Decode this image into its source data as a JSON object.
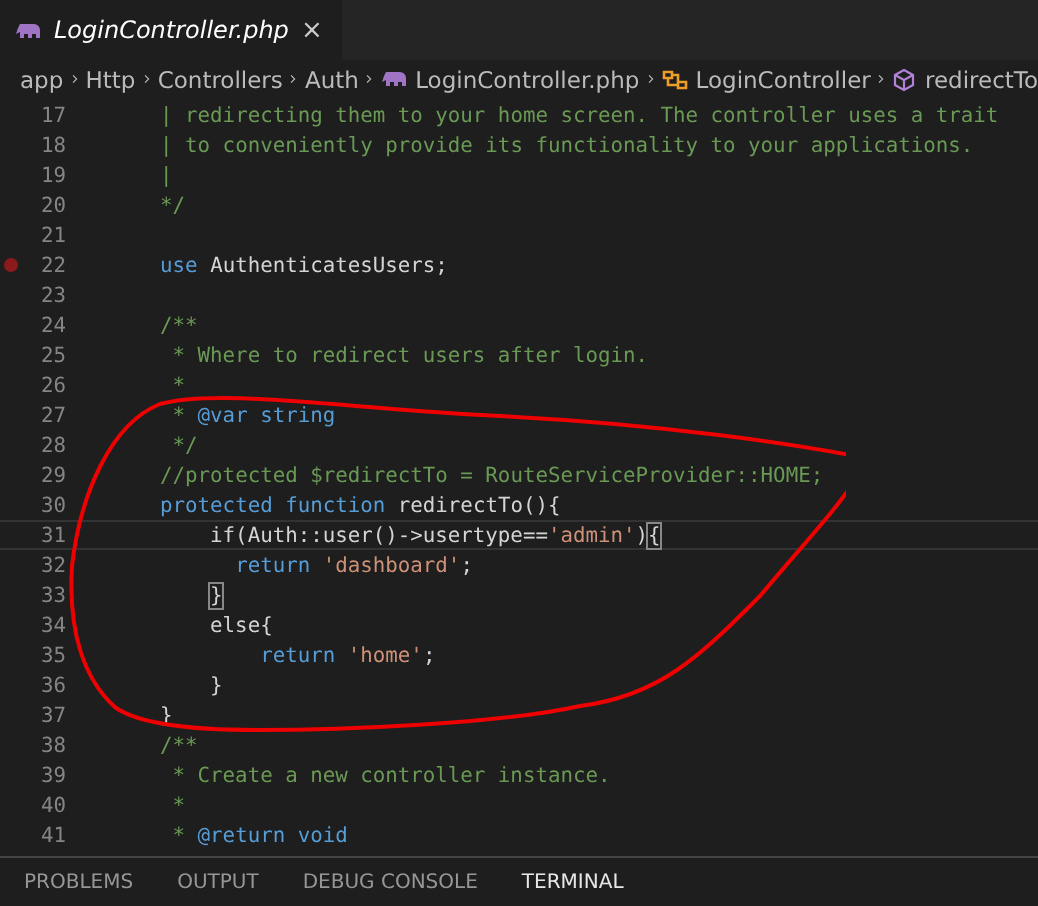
{
  "tab": {
    "label": "LoginController.php",
    "close": "×",
    "selected": true
  },
  "breadcrumb": [
    {
      "label": "app"
    },
    {
      "label": "Http"
    },
    {
      "label": "Controllers"
    },
    {
      "label": "Auth"
    },
    {
      "label": "LoginController.php",
      "kind": "php"
    },
    {
      "label": "LoginController",
      "kind": "class"
    },
    {
      "label": "redirectTo",
      "kind": "method"
    }
  ],
  "lines": [
    {
      "number": "17",
      "breakpoint": false,
      "current": false,
      "tokens": [
        {
          "kind": "comment",
          "text": "    | redirecting them to your home screen. The controller uses a trait"
        }
      ]
    },
    {
      "number": "18",
      "breakpoint": false,
      "current": false,
      "tokens": [
        {
          "kind": "comment",
          "text": "    | to conveniently provide its functionality to your applications."
        }
      ]
    },
    {
      "number": "19",
      "breakpoint": false,
      "current": false,
      "tokens": [
        {
          "kind": "comment",
          "text": "    |"
        }
      ]
    },
    {
      "number": "20",
      "breakpoint": false,
      "current": false,
      "tokens": [
        {
          "kind": "comment",
          "text": "    */"
        }
      ]
    },
    {
      "number": "21",
      "breakpoint": false,
      "current": false
    },
    {
      "number": "22",
      "breakpoint": true,
      "current": false,
      "tokens": [
        {
          "kind": "keyword",
          "text": "    use"
        },
        {
          "kind": "plain",
          "text": " AuthenticatesUsers;"
        }
      ]
    },
    {
      "number": "23",
      "breakpoint": false,
      "current": false
    },
    {
      "number": "24",
      "breakpoint": false,
      "current": false,
      "tokens": [
        {
          "kind": "comment",
          "text": "    /**"
        }
      ]
    },
    {
      "number": "25",
      "breakpoint": false,
      "current": false,
      "tokens": [
        {
          "kind": "comment",
          "text": "     * Where to redirect users after login."
        }
      ]
    },
    {
      "number": "26",
      "breakpoint": false,
      "current": false,
      "tokens": [
        {
          "kind": "comment",
          "text": "     *"
        }
      ]
    },
    {
      "number": "27",
      "breakpoint": false,
      "current": false,
      "tokens": [
        {
          "kind": "comment",
          "text": "     * "
        },
        {
          "kind": "doctag",
          "text": "@var string"
        }
      ]
    },
    {
      "number": "28",
      "breakpoint": false,
      "current": false,
      "tokens": [
        {
          "kind": "comment",
          "text": "     */"
        }
      ]
    },
    {
      "number": "29",
      "breakpoint": false,
      "current": false,
      "tokens": [
        {
          "kind": "comment",
          "text": "    //protected $redirectTo = RouteServiceProvider::HOME;"
        }
      ]
    },
    {
      "number": "30",
      "breakpoint": false,
      "current": false,
      "tokens": [
        {
          "kind": "keyword",
          "text": "    protected function"
        },
        {
          "kind": "plain",
          "text": " redirectTo(){"
        }
      ]
    },
    {
      "number": "31",
      "breakpoint": false,
      "current": true,
      "tokens": [
        {
          "kind": "plain",
          "text": "        if(Auth::user()->usertype=="
        },
        {
          "kind": "string",
          "text": "'admin'"
        },
        {
          "kind": "plain",
          "text": ")"
        },
        {
          "kind": "bracket",
          "text": "{"
        }
      ]
    },
    {
      "number": "32",
      "breakpoint": false,
      "current": false,
      "tokens": [
        {
          "kind": "keyword",
          "text": "          return"
        },
        {
          "kind": "string",
          "text": " 'dashboard'"
        },
        {
          "kind": "plain",
          "text": ";"
        }
      ]
    },
    {
      "number": "33",
      "breakpoint": false,
      "current": false,
      "tokens": [
        {
          "kind": "bracket",
          "text": "        }"
        }
      ]
    },
    {
      "number": "34",
      "breakpoint": false,
      "current": false,
      "tokens": [
        {
          "kind": "plain",
          "text": "        else{"
        }
      ]
    },
    {
      "number": "35",
      "breakpoint": false,
      "current": false,
      "tokens": [
        {
          "kind": "keyword",
          "text": "            return"
        },
        {
          "kind": "string",
          "text": " 'home'"
        },
        {
          "kind": "plain",
          "text": ";"
        }
      ]
    },
    {
      "number": "36",
      "breakpoint": false,
      "current": false,
      "tokens": [
        {
          "kind": "plain",
          "text": "        }"
        }
      ]
    },
    {
      "number": "37",
      "breakpoint": false,
      "current": false,
      "tokens": [
        {
          "kind": "plain",
          "text": "    }"
        }
      ]
    },
    {
      "number": "38",
      "breakpoint": false,
      "current": false,
      "tokens": [
        {
          "kind": "comment",
          "text": "    /**"
        }
      ]
    },
    {
      "number": "39",
      "breakpoint": false,
      "current": false,
      "tokens": [
        {
          "kind": "comment",
          "text": "     * Create a new controller instance."
        }
      ]
    },
    {
      "number": "40",
      "breakpoint": false,
      "current": false,
      "tokens": [
        {
          "kind": "comment",
          "text": "     *"
        }
      ]
    },
    {
      "number": "41",
      "breakpoint": false,
      "current": false,
      "tokens": [
        {
          "kind": "comment",
          "text": "     * "
        },
        {
          "kind": "doctag",
          "text": "@return void"
        }
      ]
    }
  ],
  "panel_tabs": [
    {
      "label": "PROBLEMS",
      "selected": false
    },
    {
      "label": "OUTPUT",
      "selected": false
    },
    {
      "label": "DEBUG CONSOLE",
      "selected": false
    },
    {
      "label": "TERMINAL",
      "selected": true
    }
  ]
}
